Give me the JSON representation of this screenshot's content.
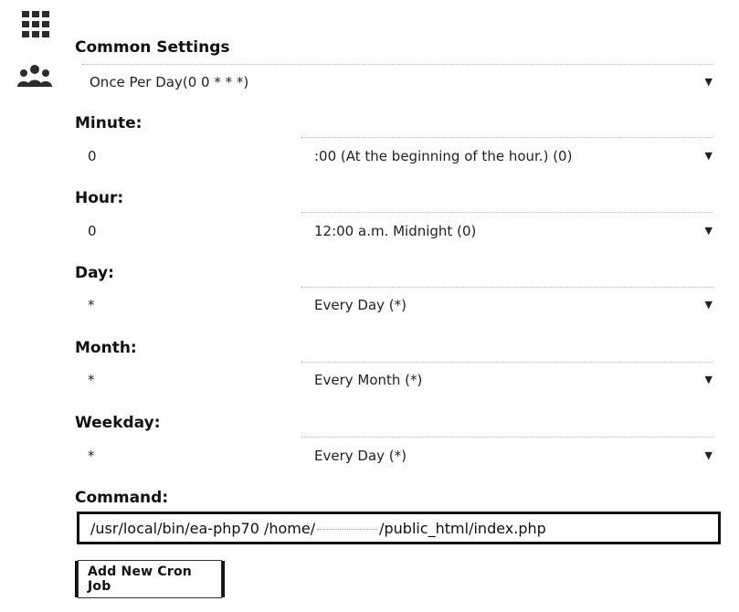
{
  "sections": {
    "common": {
      "label": "Common Settings",
      "value": "Once Per Day(0 0 * * *)"
    },
    "minute": {
      "label": "Minute:",
      "input": "0",
      "select": ":00 (At the beginning of the hour.) (0)"
    },
    "hour": {
      "label": "Hour:",
      "input": "0",
      "select": "12:00 a.m. Midnight (0)"
    },
    "day": {
      "label": "Day:",
      "input": "*",
      "select": "Every Day (*)"
    },
    "month": {
      "label": "Month:",
      "input": "*",
      "select": "Every Month (*)"
    },
    "weekday": {
      "label": "Weekday:",
      "input": "*",
      "select": "Every Day (*)"
    },
    "command": {
      "label": "Command:",
      "prefix": "/usr/local/bin/ea-php70 /home/",
      "suffix": "/public_html/index.php"
    }
  },
  "button": {
    "label": "Add New Cron Job"
  },
  "caret": "▼",
  "icons": {
    "apps": "grid-icon",
    "users": "users-icon"
  }
}
